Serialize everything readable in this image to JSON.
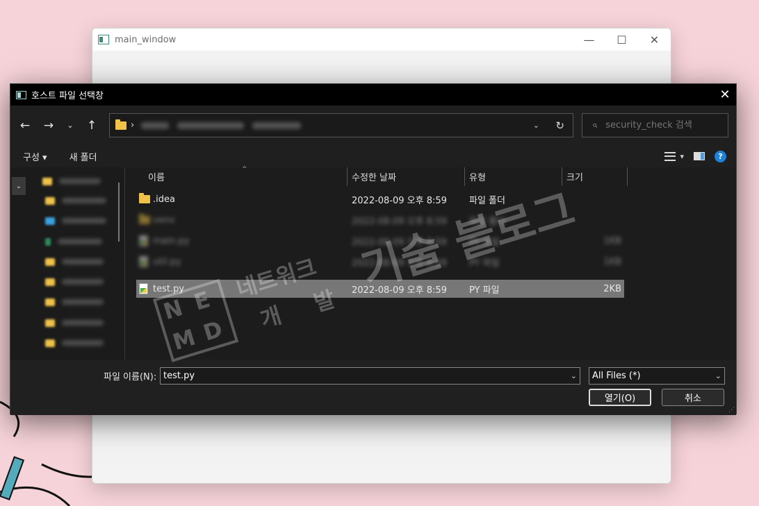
{
  "main_window": {
    "title": "main_window",
    "controls": {
      "minimize": "—",
      "maximize": "☐",
      "close": "✕"
    }
  },
  "dialog": {
    "title": "호스트 파일 선택창",
    "close": "✕",
    "nav": {
      "back": "←",
      "forward": "→",
      "recent": "⌄",
      "up": "↑"
    },
    "address": {
      "separator": "›",
      "dropdown": "⌄",
      "refresh": "↻"
    },
    "search": {
      "placeholder": "security_check 검색",
      "icon": "⌕"
    },
    "toolbar": {
      "organize": "구성 ▾",
      "new_folder": "새 폴더",
      "view_dropdown": "▾",
      "help": "?"
    },
    "columns": {
      "name": "이름",
      "date": "수정한 날짜",
      "type": "유형",
      "size": "크기",
      "sort": "^"
    },
    "files": [
      {
        "name": ".idea",
        "date": "2022-08-09 오후 8:59",
        "type": "파일 폴더",
        "size": "",
        "kind": "folder",
        "blurred": false,
        "selected": false
      },
      {
        "name": "venv",
        "date": "2022-08-09 오후 8:59",
        "type": "파일 폴더",
        "size": "",
        "kind": "folder",
        "blurred": true,
        "selected": false
      },
      {
        "name": "main.py",
        "date": "2022-08-09 오후 8:59",
        "type": "PY 파일",
        "size": "1KB",
        "kind": "py",
        "blurred": true,
        "selected": false
      },
      {
        "name": "util.py",
        "date": "2022-08-09 오후 8:59",
        "type": "PY 파일",
        "size": "1KB",
        "kind": "py",
        "blurred": true,
        "selected": false
      },
      {
        "name": "test.py",
        "date": "2022-08-09 오후 8:59",
        "type": "PY 파일",
        "size": "2KB",
        "kind": "py",
        "blurred": false,
        "selected": true
      }
    ],
    "filename_label": "파일 이름(N):",
    "filename_value": "test.py",
    "filetype_value": "All Files (*)",
    "open_label": "열기(O)",
    "cancel_label": "취소",
    "dropdown_glyph": "⌄",
    "expand_glyph": "⌄"
  },
  "watermark": {
    "logo_letters": [
      "N",
      "E",
      "M",
      "D"
    ],
    "line1": "네트워크",
    "line2": "개 발",
    "big": "기술 블로그"
  },
  "colors": {
    "background": "#f6d3d8",
    "dialog_bg": "#1c1c1c",
    "selected_row": "#777777",
    "folder": "#f0c24a",
    "help_blue": "#1e82d8"
  }
}
